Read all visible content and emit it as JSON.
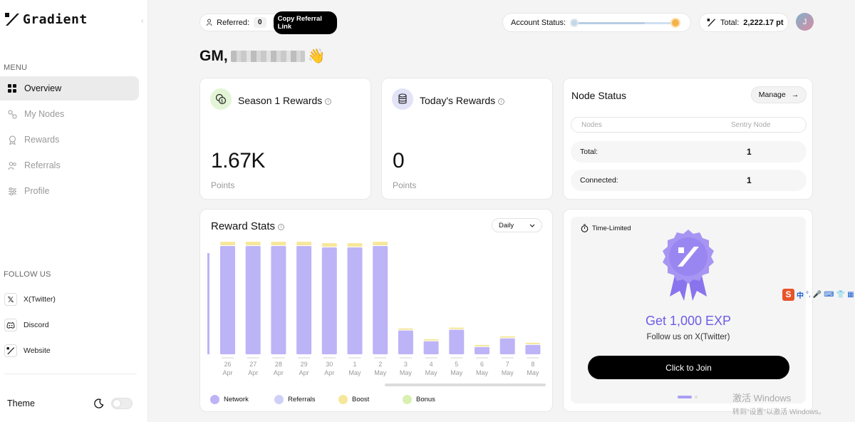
{
  "brand": {
    "name": "Gradient"
  },
  "sidebar": {
    "menu_label": "MENU",
    "items": [
      {
        "label": "Overview",
        "icon": "grid-icon",
        "active": true
      },
      {
        "label": "My Nodes",
        "icon": "nodes-icon"
      },
      {
        "label": "Rewards",
        "icon": "rewards-icon"
      },
      {
        "label": "Referrals",
        "icon": "referrals-icon"
      },
      {
        "label": "Profile",
        "icon": "profile-icon"
      }
    ],
    "follow_label": "FOLLOW US",
    "social": [
      {
        "label": "X(Twitter)",
        "icon": "x-icon"
      },
      {
        "label": "Discord",
        "icon": "discord-icon"
      },
      {
        "label": "Website",
        "icon": "gradient-icon"
      }
    ],
    "theme_label": "Theme"
  },
  "topbar": {
    "referred_label": "Referred:",
    "referred_count": "0",
    "copy_link_label": "Copy Referral Link",
    "account_status_label": "Account Status:",
    "account_status_progress": 0.7,
    "total_label": "Total:",
    "total_value": "2,222.17 pt",
    "avatar_initial": "J"
  },
  "greeting": {
    "prefix": "GM,",
    "emoji": "👋"
  },
  "season_card": {
    "title": "Season 1 Rewards",
    "value": "1.67K",
    "unit": "Points"
  },
  "today_card": {
    "title": "Today's Rewards",
    "value": "0",
    "unit": "Points"
  },
  "node_status": {
    "title": "Node Status",
    "manage_label": "Manage",
    "manage_arrow": "→",
    "header": [
      "Nodes",
      "Sentry Node"
    ],
    "rows": [
      {
        "label": "Total:",
        "value": "1"
      },
      {
        "label": "Connected:",
        "value": "1"
      }
    ]
  },
  "reward_stats": {
    "title": "Reward Stats",
    "period": "Daily",
    "legend": [
      {
        "label": "Network",
        "color": "#bdb3f7"
      },
      {
        "label": "Referrals",
        "color": "#cfd0f7"
      },
      {
        "label": "Boost",
        "color": "#f6e79a"
      },
      {
        "label": "Bonus",
        "color": "#d8f0b0"
      }
    ]
  },
  "chart_data": {
    "type": "bar",
    "stacked": true,
    "categories": [
      [
        "26",
        "Apr"
      ],
      [
        "27",
        "Apr"
      ],
      [
        "28",
        "Apr"
      ],
      [
        "29",
        "Apr"
      ],
      [
        "30",
        "Apr"
      ],
      [
        "1",
        "May"
      ],
      [
        "2",
        "May"
      ],
      [
        "3",
        "May"
      ],
      [
        "4",
        "May"
      ],
      [
        "5",
        "May"
      ],
      [
        "6",
        "May"
      ],
      [
        "7",
        "May"
      ],
      [
        "8",
        "May"
      ]
    ],
    "series": [
      {
        "name": "Network",
        "color": "#bdb3f7",
        "values": [
          150,
          150,
          150,
          150,
          148,
          148,
          150,
          33,
          18,
          34,
          10,
          22,
          13
        ]
      },
      {
        "name": "Boost",
        "color": "#f6e79a",
        "values": [
          5,
          5,
          5,
          5,
          5,
          5,
          5,
          2,
          1,
          2,
          0.5,
          1.5,
          1
        ]
      }
    ],
    "partial_left_bar": true
  },
  "promo": {
    "tag": "Time-Limited",
    "title": "Get 1,000 EXP",
    "subtitle": "Follow us on X(Twitter)",
    "button": "Click to Join"
  },
  "system": {
    "ime_label": "中",
    "watermark_line1": "激活 Windows",
    "watermark_line2": "转到\"设置\"以激活 Windows。"
  }
}
